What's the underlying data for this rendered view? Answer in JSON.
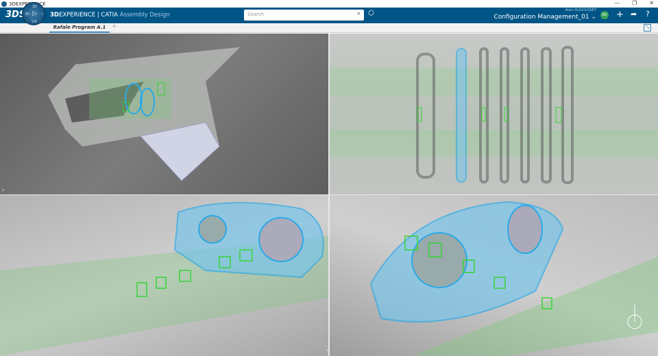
{
  "window": {
    "title": "3DEXPERIENCE",
    "controls": [
      "—",
      "❐",
      "✕"
    ]
  },
  "header": {
    "brand_bold": "3D",
    "brand_rest": "EXPERIENCE | CATIA",
    "app": "Assembly Design",
    "compass": {
      "top": "3D",
      "left": "3D",
      "right": "i",
      "bottom": "V.R"
    },
    "search_placeholder": "Search",
    "user": "Alain DUGOUSSET",
    "collaborative_space": "Configuration Management_01",
    "avatar_initials": "AD"
  },
  "tabs": [
    {
      "label": "Rafale Program A.1",
      "active": true
    }
  ],
  "colors": {
    "header": "#005587",
    "selection": "#29a9e8",
    "highlight": "#35d435"
  }
}
